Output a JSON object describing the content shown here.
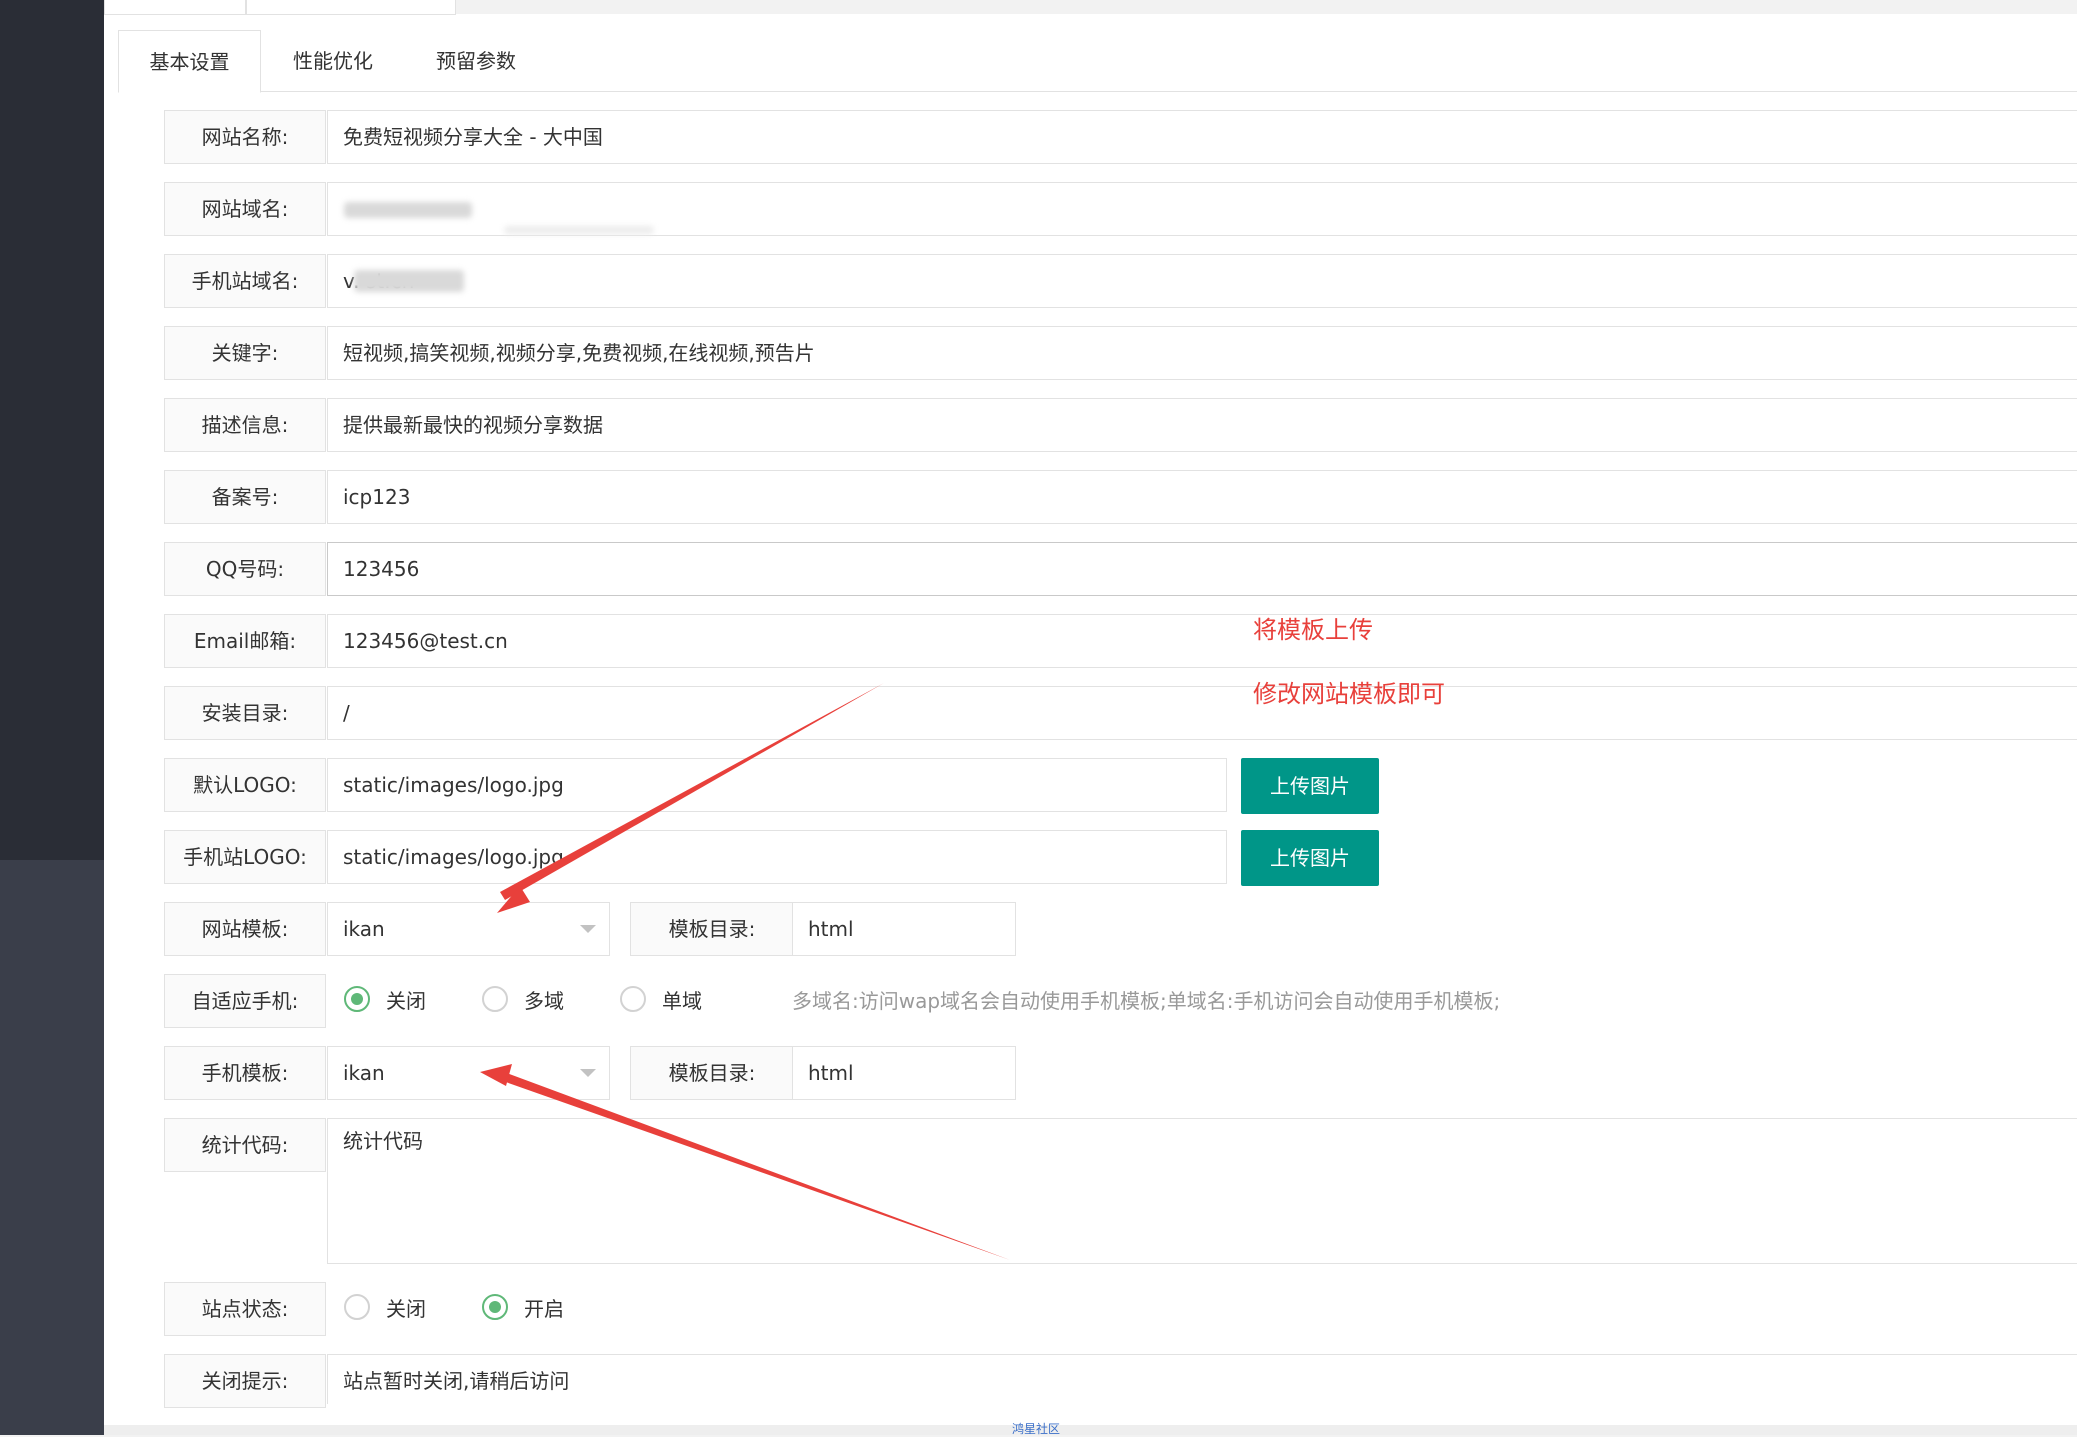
{
  "tabs": [
    "基本设置",
    "性能优化",
    "预留参数"
  ],
  "fields": {
    "site_name": {
      "label": "网站名称:",
      "value": "免费短视频分享大全 - 大中国"
    },
    "site_domain": {
      "label": "网站域名:",
      "value": ""
    },
    "mobile_domain": {
      "label": "手机站域名:",
      "value": "v.        st.cn"
    },
    "keywords": {
      "label": "关键字:",
      "value": "短视频,搞笑视频,视频分享,免费视频,在线视频,预告片"
    },
    "description": {
      "label": "描述信息:",
      "value": "提供最新最快的视频分享数据"
    },
    "icp": {
      "label": "备案号:",
      "value": "icp123"
    },
    "qq": {
      "label": "QQ号码:",
      "value": "123456"
    },
    "email": {
      "label": "Email邮箱:",
      "value": "123456@test.cn"
    },
    "install_dir": {
      "label": "安装目录:",
      "value": "/"
    },
    "default_logo": {
      "label": "默认LOGO:",
      "value": "static/images/logo.jpg",
      "button": "上传图片"
    },
    "mobile_logo": {
      "label": "手机站LOGO:",
      "value": "static/images/logo.jpg",
      "button": "上传图片"
    },
    "site_template": {
      "label": "网站模板:",
      "value": "ikan",
      "dir_label": "模板目录:",
      "dir_value": "html"
    },
    "adaptive": {
      "label": "自适应手机:",
      "options": [
        "关闭",
        "多域",
        "单域"
      ],
      "selected": "关闭",
      "hint": "多域名:访问wap域名会自动使用手机模板;单域名:手机访问会自动使用手机模板;"
    },
    "mobile_template": {
      "label": "手机模板:",
      "value": "ikan",
      "dir_label": "模板目录:",
      "dir_value": "html"
    },
    "stats_code": {
      "label": "统计代码:",
      "value": "统计代码"
    },
    "site_status": {
      "label": "站点状态:",
      "options": [
        "关闭",
        "开启"
      ],
      "selected": "开启"
    },
    "close_tip": {
      "label": "关闭提示:",
      "value": "站点暂时关闭,请稍后访问"
    }
  },
  "annotations": [
    "将模板上传",
    "修改网站模板即可"
  ],
  "watermark": "鸿星社区",
  "colors": {
    "accent": "#009688",
    "radio": "#5fb878",
    "annotation": "#e8403b"
  }
}
